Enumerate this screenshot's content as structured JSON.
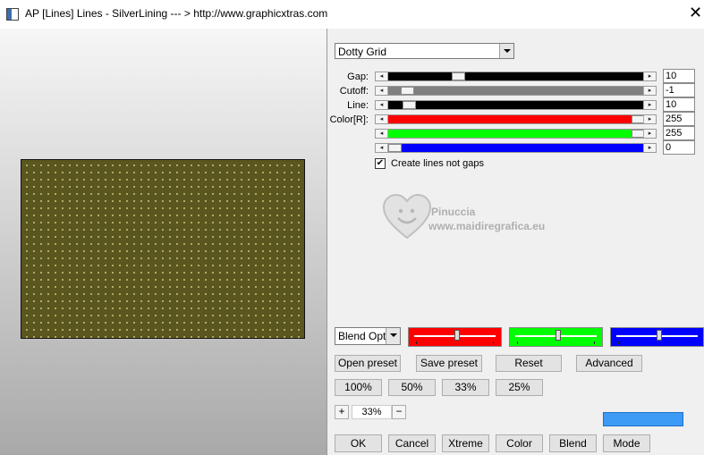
{
  "window": {
    "title": "AP [Lines]  Lines - SilverLining     --- > http://www.graphicxtras.com"
  },
  "preset_select": {
    "value": "Dotty Grid"
  },
  "params": [
    {
      "label": "Gap:",
      "value": "10",
      "fraction": 0.26,
      "fill": "#000000"
    },
    {
      "label": "Cutoff:",
      "value": "-1",
      "fraction": 0.05,
      "fill": "#808080"
    },
    {
      "label": "Line:",
      "value": "10",
      "fraction": 0.06,
      "fill": "#000000"
    },
    {
      "label": "Color[R]:",
      "value": "255",
      "fraction": 1.0,
      "fill": "#ff0000"
    },
    {
      "label": "",
      "value": "255",
      "fraction": 1.0,
      "fill": "#00ff00"
    },
    {
      "label": "",
      "value": "0",
      "fraction": 0.0,
      "fill": "#0000ff"
    }
  ],
  "checkbox": {
    "label": "Create lines not gaps",
    "checked": true
  },
  "watermark": {
    "line1": "Pinuccia",
    "line2": "www.maidiregrafica.eu"
  },
  "blend_select": {
    "value": "Blend Optio"
  },
  "color_boxes": [
    {
      "color": "#ff0000",
      "level": 0.5
    },
    {
      "color": "#00ff00",
      "level": 0.5
    },
    {
      "color": "#0000ff",
      "level": 0.5
    }
  ],
  "preset_buttons": {
    "open": "Open preset",
    "save": "Save preset",
    "reset": "Reset",
    "advanced": "Advanced"
  },
  "zoom_buttons": [
    "100%",
    "50%",
    "33%",
    "25%"
  ],
  "zoom": {
    "plus": "+",
    "value": "33%",
    "minus": "−"
  },
  "accent_color": "#3d9af5",
  "bottom_buttons": [
    "OK",
    "Cancel",
    "Xtreme",
    "Color",
    "Blend",
    "Mode"
  ]
}
